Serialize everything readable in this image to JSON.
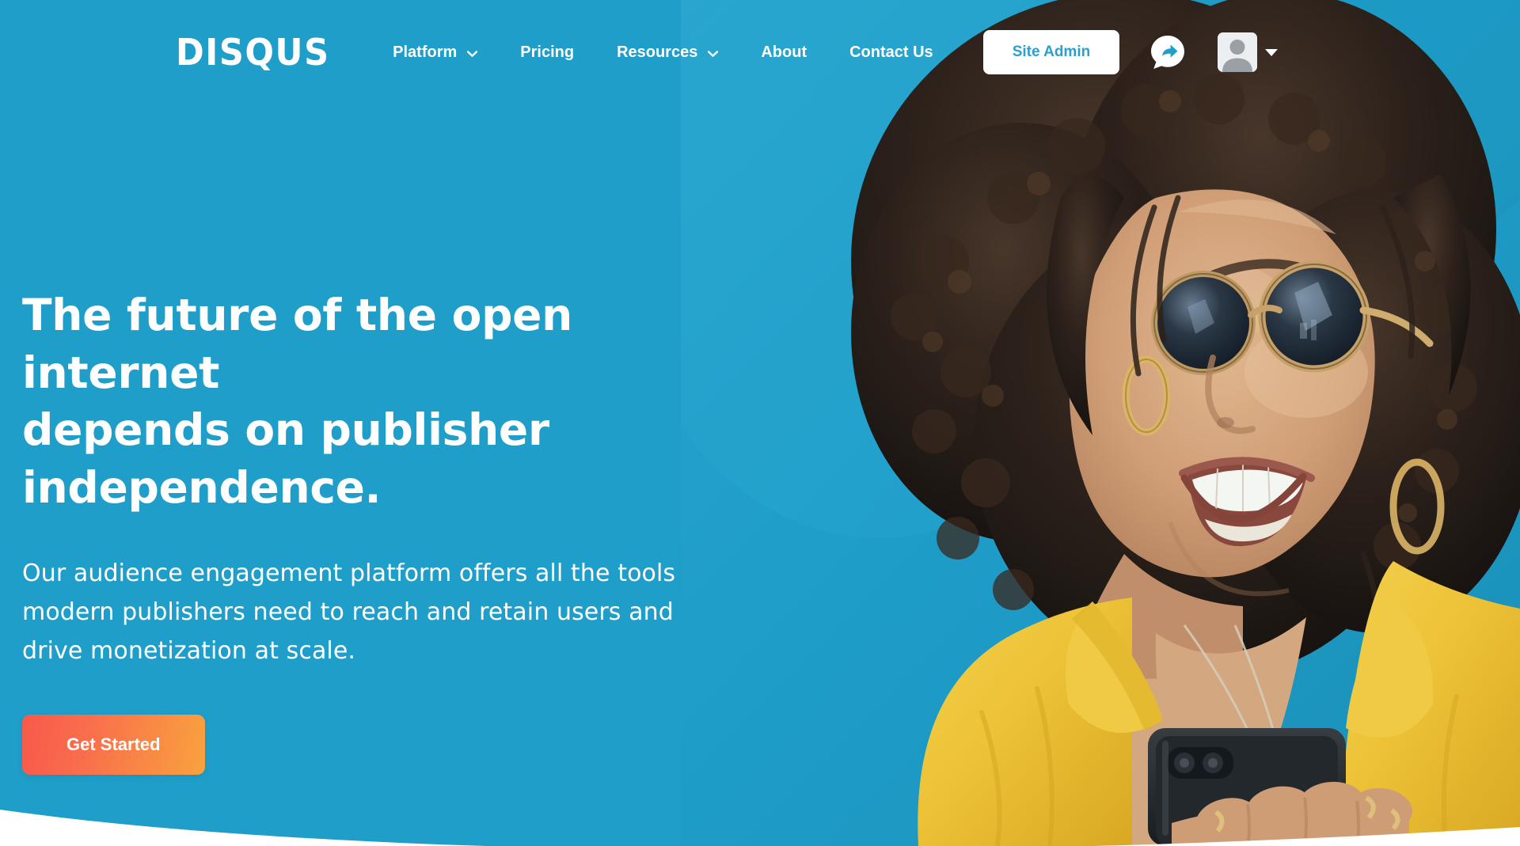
{
  "brand": {
    "logo_text": "DISQUS",
    "accent_blue": "#1f9ec9",
    "admin_text_blue": "#2a9fd0",
    "cta_gradient_start": "#f8594b",
    "cta_gradient_end": "#f9a23e",
    "text_white": "#ffffff"
  },
  "nav": {
    "items": [
      {
        "label": "Platform",
        "has_dropdown": true,
        "icon": "chevron-down-icon"
      },
      {
        "label": "Pricing",
        "has_dropdown": false,
        "icon": ""
      },
      {
        "label": "Resources",
        "has_dropdown": true,
        "icon": "chevron-down-icon"
      },
      {
        "label": "About",
        "has_dropdown": false,
        "icon": ""
      },
      {
        "label": "Contact Us",
        "has_dropdown": false,
        "icon": ""
      }
    ],
    "site_admin_label": "Site Admin",
    "share_icon": "share-bubble-icon",
    "avatar_icon": "user-avatar-icon",
    "avatar_caret_icon": "caret-down-icon"
  },
  "hero": {
    "headline_line1": "The future of the open internet",
    "headline_line2": "depends on publisher",
    "headline_line3": "independence.",
    "subcopy_line1": "Our audience engagement platform offers all the tools",
    "subcopy_line2": "modern publishers need to reach and retain users and",
    "subcopy_line3": "drive monetization at scale.",
    "cta_label": "Get Started",
    "photo_alt": "smiling-woman-with-sunglasses-holding-phone"
  }
}
